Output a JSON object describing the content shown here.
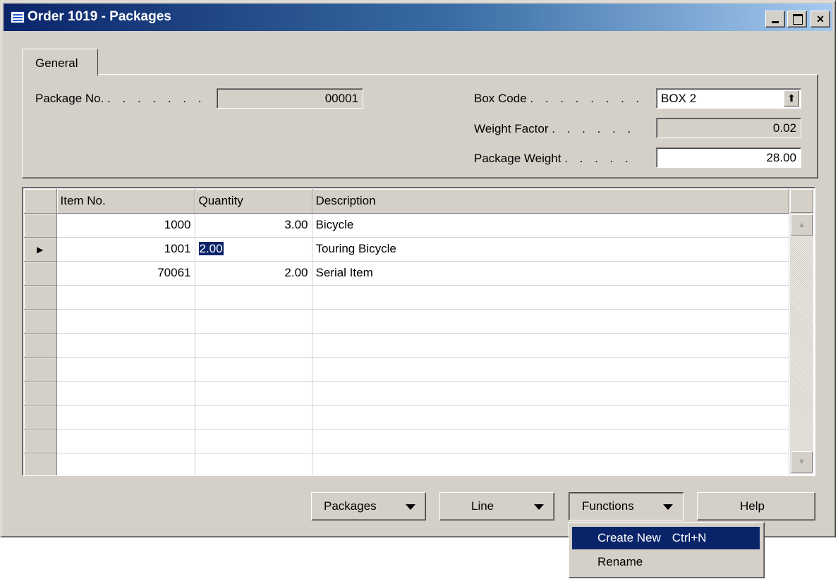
{
  "window": {
    "title": "Order 1019 - Packages",
    "min_label": "_",
    "close_label": "×"
  },
  "tab": {
    "label": "General"
  },
  "header": {
    "package_no_label": "Package No.",
    "package_no_dots": ". . . . . . .",
    "package_no_value": "00001",
    "box_code_label": "Box Code",
    "box_code_dots": ". . . . . . . .",
    "box_code_value": "BOX 2",
    "box_code_lookup": "⬆",
    "weight_factor_label": "Weight Factor",
    "weight_factor_dots": ". . . . . .",
    "weight_factor_value": "0.02",
    "package_weight_label": "Package Weight",
    "package_weight_dots": ". . . . .",
    "package_weight_value": "28.00"
  },
  "lines": {
    "columns": [
      "Item No.",
      "Quantity",
      "Description"
    ],
    "rows": [
      {
        "item_no": "1000",
        "quantity": "3.00",
        "description": "Bicycle"
      },
      {
        "item_no": "1001",
        "quantity": "2.00",
        "description": "Touring Bicycle",
        "current": true
      },
      {
        "item_no": "70061",
        "quantity": "2.00",
        "description": "Serial Item"
      }
    ],
    "current_row_marker": "▶",
    "scroll_up": "▲",
    "scroll_down": "▼"
  },
  "buttons": {
    "packages": "Packages",
    "line": "Line",
    "functions": "Functions",
    "help": "Help"
  },
  "functions_menu": {
    "items": [
      {
        "label": "Create New",
        "shortcut": "Ctrl+N"
      },
      {
        "label": "Rename",
        "shortcut": ""
      }
    ]
  }
}
